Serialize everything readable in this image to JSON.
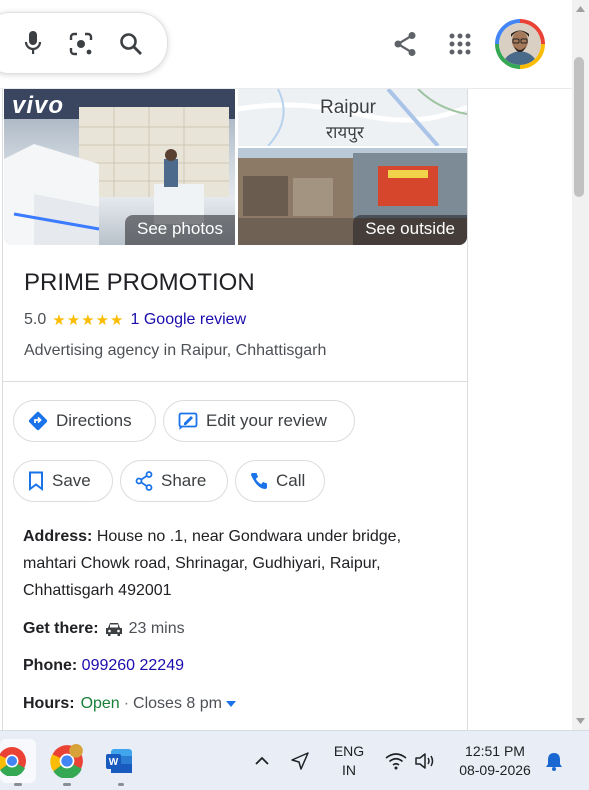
{
  "panel": {
    "photos": {
      "see_photos": "See photos",
      "see_outside": "See outside",
      "brand_text": "vivo",
      "map_label_en": "Raipur",
      "map_label_hi": "रायपुर"
    },
    "business_name": "PRIME PROMOTION",
    "rating": "5.0",
    "stars": "★★★★★",
    "review_link": "1 Google review",
    "category": "Advertising agency in Raipur, Chhattisgarh",
    "buttons": {
      "directions": "Directions",
      "edit_review": "Edit your review",
      "save": "Save",
      "share": "Share",
      "call": "Call"
    },
    "address_label": "Address:",
    "address_lines": [
      "House no .1, near Gondwara under bridge,",
      "mahtari Chowk road, Shrinagar, Gudhiyari, Raipur,",
      "Chhattisgarh 492001"
    ],
    "get_there_label": "Get there:",
    "get_there_value": "23 mins",
    "phone_label": "Phone:",
    "phone_value": "099260 22249",
    "hours_label": "Hours:",
    "hours_open": "Open",
    "hours_sep": "·",
    "hours_closes": "Closes 8 pm"
  },
  "taskbar": {
    "lang_top": "ENG",
    "lang_bottom": "IN",
    "time": "12:51 PM",
    "date": "08-09-2026"
  }
}
